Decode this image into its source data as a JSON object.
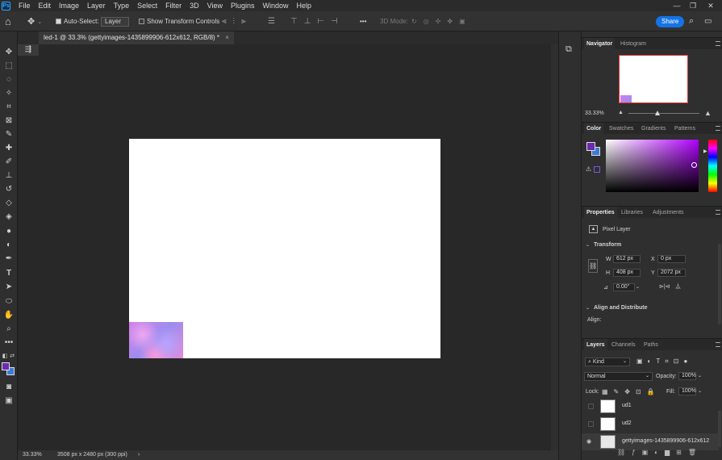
{
  "app": {
    "logo": "Ps"
  },
  "menu": [
    "File",
    "Edit",
    "Image",
    "Layer",
    "Type",
    "Select",
    "Filter",
    "3D",
    "View",
    "Plugins",
    "Window",
    "Help"
  ],
  "options": {
    "auto_select_label": "Auto-Select:",
    "layer_select_value": "Layer",
    "show_transform_label": "Show Transform Controls",
    "more_label": "•••",
    "mode_3d_label": "3D Mode:",
    "share_label": "Share"
  },
  "document_tab": {
    "title": "led-1 @ 33.3% (gettyimages-1435899906-612x612, RGB/8) *",
    "close": "×"
  },
  "status": {
    "zoom": "33.33%",
    "doc_info": "3508 px x 2480 px (300 ppi)",
    "arrow": "›"
  },
  "navigator": {
    "tabs": [
      "Navigator",
      "Histogram"
    ],
    "zoom": "33.33%"
  },
  "color_panel": {
    "tabs": [
      "Color",
      "Swatches",
      "Gradients",
      "Patterns"
    ],
    "fg_color": "#6b2bb0",
    "bg_color": "#3c7bd6"
  },
  "properties": {
    "tabs": [
      "Properties",
      "Libraries",
      "Adjustments"
    ],
    "kind_label": "Pixel Layer",
    "transform_label": "Transform",
    "w_label": "W",
    "w_value": "612 px",
    "h_label": "H",
    "h_value": "408 px",
    "x_label": "X",
    "x_value": "0 px",
    "y_label": "Y",
    "y_value": "2072 px",
    "angle_value": "0.00°",
    "align_label": "Align and Distribute",
    "align_sub": "Align:"
  },
  "layers_panel": {
    "tabs": [
      "Layers",
      "Channels",
      "Paths"
    ],
    "kind_filter": "Kind",
    "blend_mode": "Normal",
    "opacity_label": "Opacity:",
    "opacity_value": "100%",
    "lock_label": "Lock:",
    "fill_label": "Fill:",
    "fill_value": "100%",
    "layers": [
      {
        "name": "ud1",
        "visible": false
      },
      {
        "name": "ud2",
        "visible": false
      },
      {
        "name": "gettyimages-1435899906-612x612",
        "visible": true
      }
    ]
  }
}
